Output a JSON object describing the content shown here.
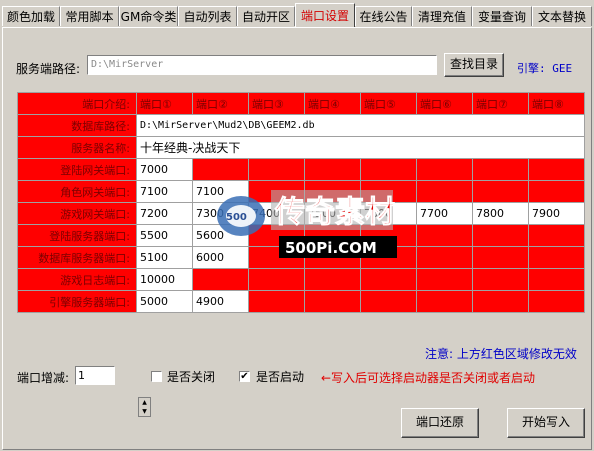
{
  "tabs": [
    {
      "label": "颜色加载",
      "active": false
    },
    {
      "label": "常用脚本",
      "active": false
    },
    {
      "label": "GM命令类",
      "active": false
    },
    {
      "label": "自动列表",
      "active": false
    },
    {
      "label": "自动开区",
      "active": false
    },
    {
      "label": "端口设置",
      "active": true
    },
    {
      "label": "在线公告",
      "active": false
    },
    {
      "label": "清理充值",
      "active": false
    },
    {
      "label": "变量查询",
      "active": false
    },
    {
      "label": "文本替换",
      "active": false
    }
  ],
  "server_path": {
    "label": "服务端路径:",
    "value": "D:\\MirServer",
    "browse_label": "查找目录",
    "engine": "引擎: GEE"
  },
  "grid": {
    "corner": "端口介绍:",
    "columns": [
      "端口①",
      "端口②",
      "端口③",
      "端口④",
      "端口⑤",
      "端口⑥",
      "端口⑦",
      "端口⑧"
    ],
    "db_path_label": "数据库路径:",
    "db_path_value": "D:\\MirServer\\Mud2\\DB\\GEEM2.db",
    "server_name_label": "服务器名称:",
    "server_name_value": "十年经典-决战天下",
    "rows": [
      {
        "label": "登陆网关端口:",
        "cells": [
          "7000",
          "",
          "",
          "",
          "",
          "",
          "",
          ""
        ]
      },
      {
        "label": "角色网关端口:",
        "cells": [
          "7100",
          "7100",
          "",
          "",
          "",
          "",
          "",
          ""
        ]
      },
      {
        "label": "游戏网关端口:",
        "cells": [
          "7200",
          "7300",
          "7400",
          "7500",
          "7600",
          "7700",
          "7800",
          "7900"
        ]
      },
      {
        "label": "登陆服务器端口:",
        "cells": [
          "5500",
          "5600",
          "",
          "",
          "",
          "",
          "",
          ""
        ]
      },
      {
        "label": "数据库服务器端口:",
        "cells": [
          "5100",
          "6000",
          "",
          "",
          "",
          "",
          "",
          ""
        ]
      },
      {
        "label": "游戏日志端口:",
        "cells": [
          "10000",
          "",
          "",
          "",
          "",
          "",
          "",
          ""
        ]
      },
      {
        "label": "引擎服务器端口:",
        "cells": [
          "5000",
          "4900",
          "",
          "",
          "",
          "",
          "",
          ""
        ]
      }
    ]
  },
  "note": "注意: 上方红色区域修改无效",
  "increment": {
    "label": "端口增减:",
    "value": "1"
  },
  "checkboxes": [
    {
      "label": "是否关闭",
      "checked": false,
      "mark": ""
    },
    {
      "label": "是否启动",
      "checked": true,
      "mark": "✔"
    }
  ],
  "hint": "←写入后可选择启动器是否关闭或者启动",
  "buttons": {
    "restore": "端口还原",
    "write": "开始写入"
  },
  "watermark": {
    "text": "传奇素材",
    "url_text": "500Pi.COM",
    "badge": "500"
  },
  "colors": {
    "red_area": "#ff0000",
    "note_blue": "#0000c8",
    "active_tab": "#d40000"
  }
}
